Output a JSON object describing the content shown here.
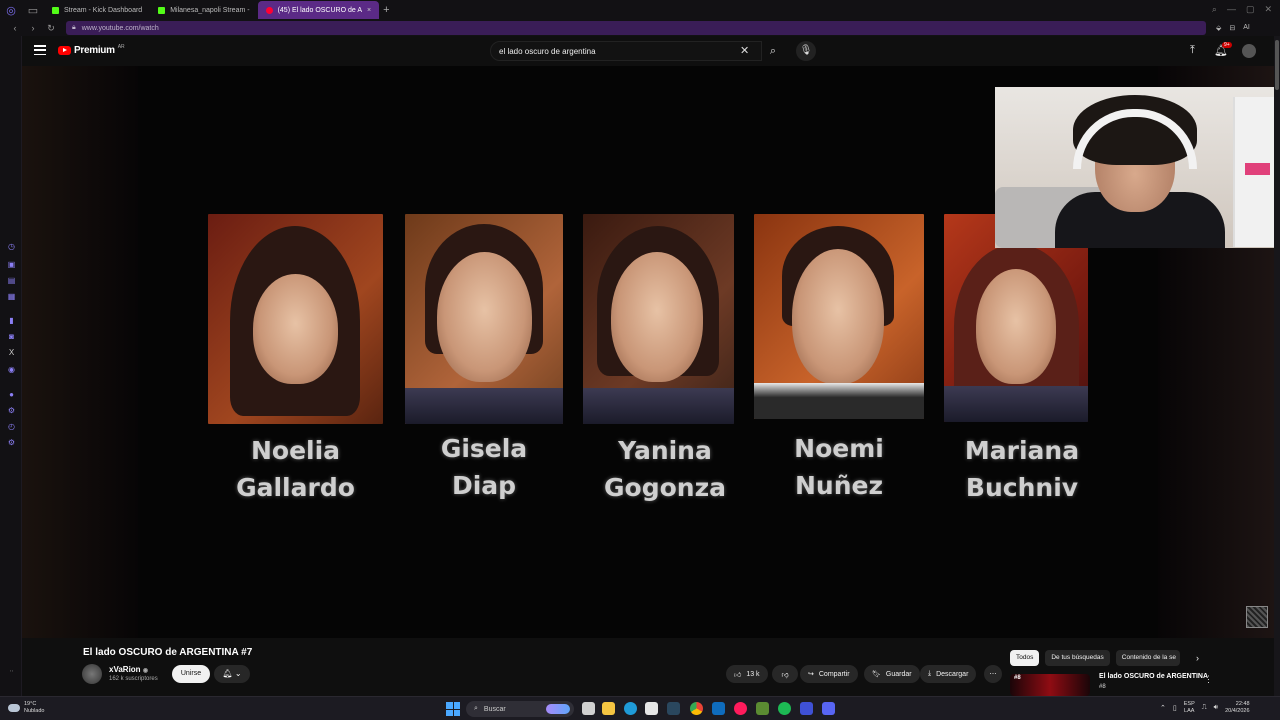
{
  "browser": {
    "tabs": [
      {
        "label": "Stream - Kick Dashboard",
        "favicon_color": "#53fc18"
      },
      {
        "label": "Milanesa_napoli Stream -",
        "favicon_color": "#53fc18"
      },
      {
        "label": "(45) El lado OSCURO de A",
        "favicon_color": "#ff0033",
        "active": true
      }
    ],
    "new_tab": "+",
    "url": "www.youtube.com/watch",
    "ai_label": "AI"
  },
  "youtube": {
    "brand": "Premium",
    "country": "AR",
    "search_query": "el lado oscuro de argentina",
    "notification_count": "9+"
  },
  "video": {
    "names": [
      {
        "first": "Noelia",
        "last": "Gallardo"
      },
      {
        "first": "Gisela",
        "last": "Diap"
      },
      {
        "first": "Yanina",
        "last": "Gogonza"
      },
      {
        "first": "Noemi",
        "last": "Nuñez"
      },
      {
        "first": "Mariana",
        "last": "Buchniv"
      }
    ]
  },
  "below": {
    "title": "El lado OSCURO de ARGENTINA #7",
    "channel": "xVaRion",
    "subscribers": "162 k suscriptores",
    "join": "Unirse",
    "likes": "13 k",
    "share": "Compartir",
    "save": "Guardar",
    "download": "Descargar",
    "chips": [
      "Todos",
      "De tus búsquedas",
      "Contenido de la se"
    ],
    "rec": {
      "num": "#8",
      "title": "El lado OSCURO de ARGENTINA",
      "sub": "#8"
    }
  },
  "taskbar": {
    "temp": "19°C",
    "weather": "Nublado",
    "search": "Buscar",
    "lang1": "ESP",
    "lang2": "LAA",
    "time": "22:48",
    "date": "20/4/2026"
  },
  "colors": {
    "accent": "#5b2a86",
    "yt_red": "#ff0000",
    "sidebar_icon": "#8b7ff5"
  }
}
